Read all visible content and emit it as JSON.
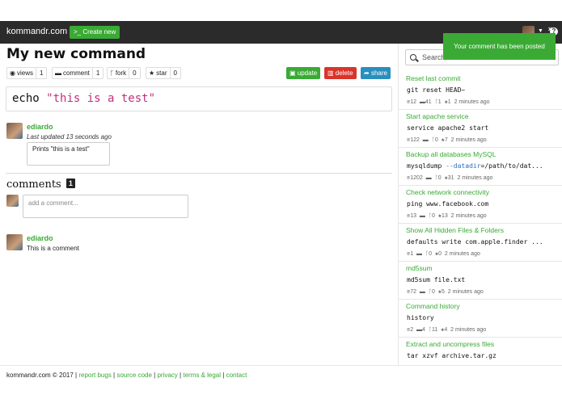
{
  "navbar": {
    "brand": "kommandr.com",
    "create_label": ">_ Create new",
    "help_icon": "?"
  },
  "command": {
    "title": "My new command",
    "counters": [
      {
        "icon": "eye-icon",
        "label": "views",
        "value": "1"
      },
      {
        "icon": "comment-icon",
        "label": "comment",
        "value": "1"
      },
      {
        "icon": "fork-icon",
        "label": "fork",
        "value": "0"
      },
      {
        "icon": "star-icon",
        "label": "star",
        "value": "0"
      }
    ],
    "actions": {
      "update": "update",
      "delete": "delete",
      "share": "share"
    },
    "code_cmd": "echo ",
    "code_str": "\"this is a test\"",
    "author": "ediardo",
    "updated": "Last updated 13 seconds ago",
    "description": "Prints \"this is a test\""
  },
  "comments": {
    "heading": "comments",
    "count": "1",
    "placeholder": "add a comment...",
    "items": [
      {
        "author": "ediardo",
        "text": "This is a comment"
      }
    ]
  },
  "sidebar": {
    "search_placeholder": "Search",
    "commands": [
      {
        "title": "Reset last commit",
        "code": "git reset HEAD~",
        "views": "12",
        "comments": "41",
        "forks": "1",
        "stars": "1",
        "time": "2 minutes ago"
      },
      {
        "title": "Start apache service",
        "code": "service apache2 start",
        "views": "122",
        "comments": "",
        "forks": "0",
        "stars": "7",
        "time": "2 minutes ago"
      },
      {
        "title": "Backup all databases MySQL",
        "code_pre": "mysqldump ",
        "code_flag": "--datadir",
        "code_post": "=/path/to/dat...",
        "views": "1202",
        "comments": "",
        "forks": "0",
        "stars": "31",
        "time": "2 minutes ago"
      },
      {
        "title": "Check network connectivity",
        "code": "ping www.facebook.com",
        "views": "13",
        "comments": "",
        "forks": "0",
        "stars": "13",
        "time": "2 minutes ago"
      },
      {
        "title": "Show All Hidden Files & Folders",
        "code": "defaults write com.apple.finder ...",
        "views": "1",
        "comments": "",
        "forks": "0",
        "stars": "0",
        "time": "2 minutes ago"
      },
      {
        "title": "md5sum",
        "code": "md5sum file.txt",
        "views": "72",
        "comments": "",
        "forks": "0",
        "stars": "5",
        "time": "2 minutes ago"
      },
      {
        "title": "Command history",
        "code": "history",
        "views": "2",
        "comments": "4",
        "forks": "11",
        "stars": "4",
        "time": "2 minutes ago"
      },
      {
        "title": "Extract and uncompress files",
        "code": "tar xzvf archive.tar.gz"
      }
    ]
  },
  "toast": {
    "message": "Your comment has been posted",
    "close": "×"
  },
  "footer": {
    "copyright": "kommandr.com © 2017 | ",
    "links": [
      "report bugs",
      "source code",
      "privacy",
      "terms & legal",
      "contact"
    ],
    "separator": " | "
  },
  "colors": {
    "accent": "#3aaa35",
    "danger": "#d9342b",
    "info": "#2a8fbd",
    "navbar": "#2b2b2b"
  }
}
